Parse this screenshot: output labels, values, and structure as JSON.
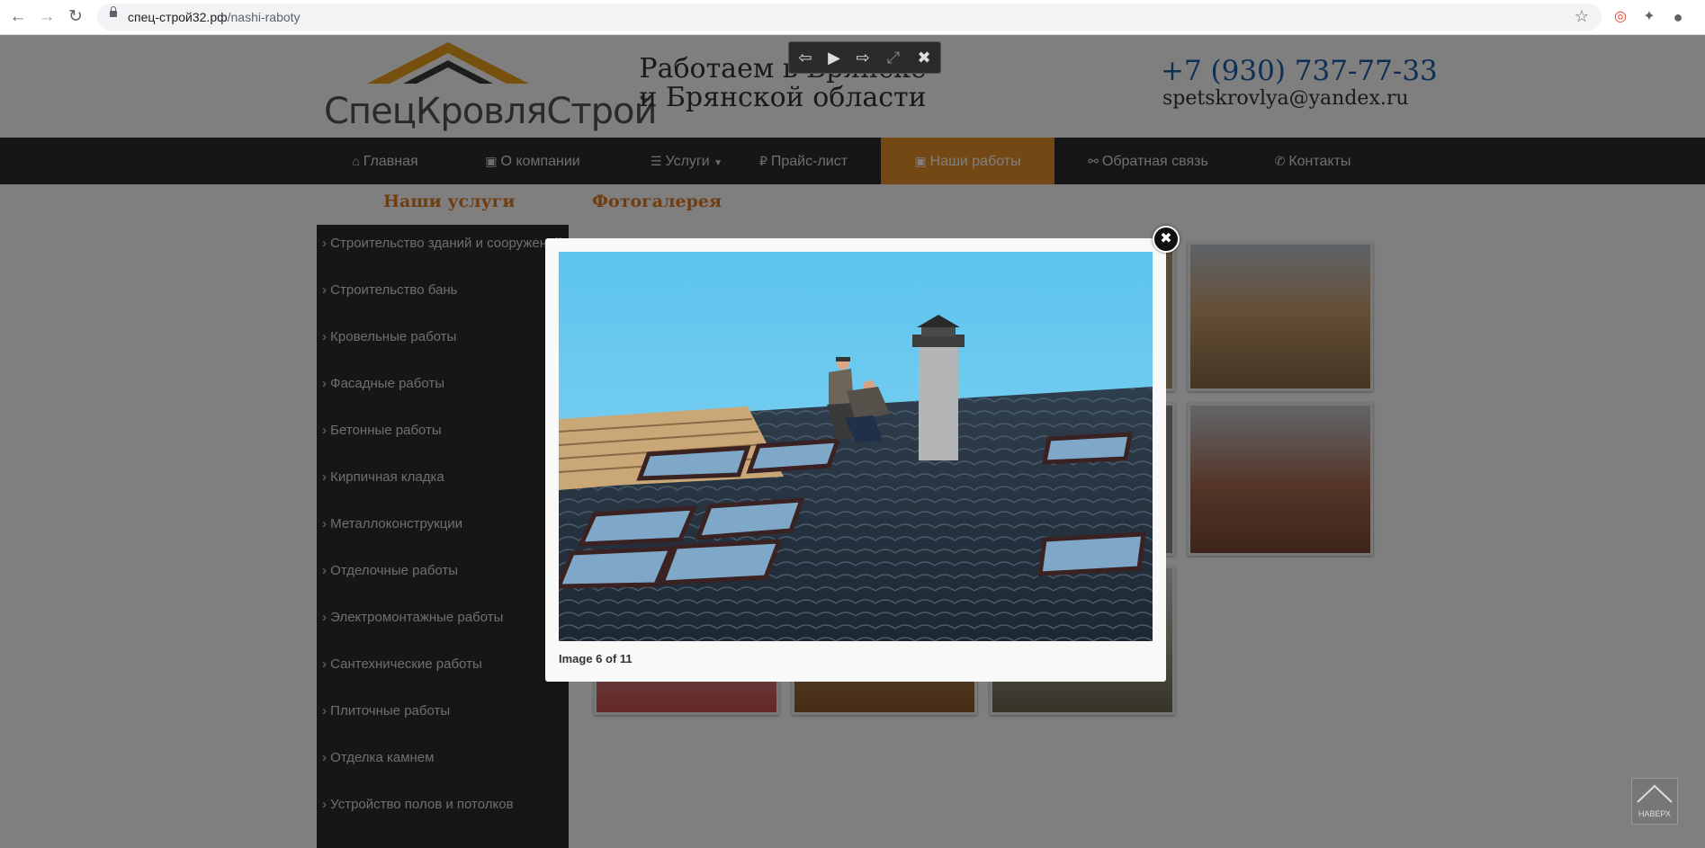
{
  "browser": {
    "url_domain": "спец-строй32.рф",
    "url_path": "/nashi-raboty"
  },
  "header": {
    "logo_text": "СпецКровляСтрой",
    "tagline": "Работаем в Брянске и Брянской области",
    "phone": "+7 (930) 737-77-33",
    "email": "spetskrovlya@yandex.ru"
  },
  "menu": {
    "items": [
      {
        "label": "Главная",
        "icon": "home-icon"
      },
      {
        "label": "О компании",
        "icon": "briefcase-icon"
      },
      {
        "label": "Услуги",
        "icon": "list-icon"
      },
      {
        "label": "Прайс-лист",
        "icon": "ruble-icon"
      },
      {
        "label": "Наши работы",
        "icon": "image-icon"
      },
      {
        "label": "Обратная связь",
        "icon": "comments-icon"
      },
      {
        "label": "Контакты",
        "icon": "phone-icon"
      }
    ],
    "active_index": 4
  },
  "sidebar": {
    "title": "Наши услуги",
    "items": [
      "Строительство зданий и сооружений",
      "Строительство бань",
      "Кровельные работы",
      "Фасадные работы",
      "Бетонные работы",
      "Кирпичная кладка",
      "Металлоконструкции",
      "Отделочные работы",
      "Электромонтажные работы",
      "Сантехнические работы",
      "Плиточные работы",
      "Отделка камнем",
      "Устройство полов и потолков"
    ]
  },
  "gallery": {
    "title": "Фотогалерея"
  },
  "lightbox": {
    "caption": "Image 6 of 11"
  },
  "to_top": {
    "label": "НАВЕРХ"
  },
  "colors": {
    "accent": "#e8912b",
    "menu_bg": "#2d2d2d",
    "phone": "#1c5ca8"
  }
}
